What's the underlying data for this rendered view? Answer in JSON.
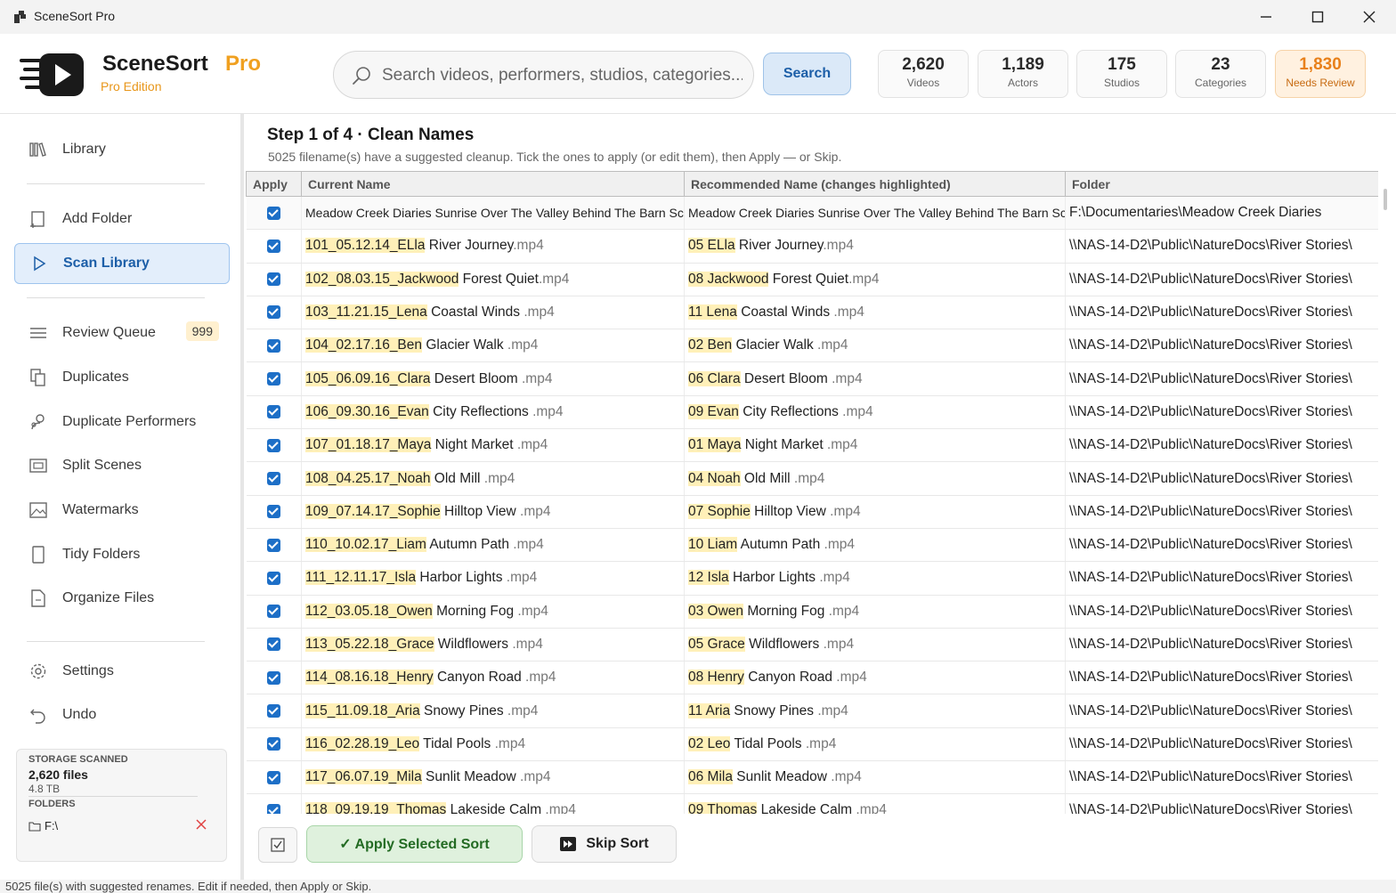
{
  "window": {
    "title": "SceneSort Pro"
  },
  "brand": {
    "name": "SceneSort",
    "pro": "Pro",
    "edition": "Pro Edition"
  },
  "search": {
    "placeholder": "Search videos, performers, studios, categories...",
    "button": "Search"
  },
  "stats": [
    {
      "value": "2,620",
      "label": "Videos"
    },
    {
      "value": "1,189",
      "label": "Actors"
    },
    {
      "value": "175",
      "label": "Studios"
    },
    {
      "value": "23",
      "label": "Categories"
    },
    {
      "value": "1,830",
      "label": "Needs Review"
    }
  ],
  "sidebar": {
    "items": [
      {
        "label": "Library",
        "icon": "library-icon"
      },
      {
        "label": "Add Folder",
        "icon": "add-folder-icon"
      },
      {
        "label": "Scan Library",
        "icon": "play-icon"
      },
      {
        "label": "Review Queue",
        "icon": "list-icon",
        "badge": "999"
      },
      {
        "label": "Duplicates",
        "icon": "copy-icon"
      },
      {
        "label": "Duplicate Performers",
        "icon": "people-icon"
      },
      {
        "label": "Split Scenes",
        "icon": "film-icon"
      },
      {
        "label": "Watermarks",
        "icon": "image-icon"
      },
      {
        "label": "Tidy Folders",
        "icon": "folder-icon"
      },
      {
        "label": "Organize Files",
        "icon": "file-icon"
      },
      {
        "label": "Settings",
        "icon": "gear-icon"
      },
      {
        "label": "Undo",
        "icon": "undo-icon"
      }
    ],
    "storage": {
      "caption": "STORAGE SCANNED",
      "files": "2,620 files",
      "size": "4.8 TB",
      "folders_caption": "FOLDERS",
      "folder": "F:\\"
    }
  },
  "step": {
    "title": "Step 1 of 4 · Clean Names",
    "subtitle": "5025 filename(s) have a suggested cleanup. Tick the ones to apply (or edit them), then Apply — or Skip."
  },
  "table": {
    "headers": [
      "Apply",
      "Current Name",
      "Recommended Name (changes highlighted)",
      "Folder"
    ],
    "first_row": {
      "current": "Meadow Creek Diaries Sunrise Over The Valley Behind The Barn Scene",
      "recommended": "Meadow Creek Diaries Sunrise Over The Valley Behind The Barn Scene",
      "folder": "F:\\Documentaries\\Meadow Creek Diaries"
    },
    "rows": [
      {
        "cur_hl": "101_05.12.14_ELla",
        "rec_hl": "05 ELla",
        "title": " River Journey",
        "ext": ".mp4"
      },
      {
        "cur_hl": "102_08.03.15_Jackwood",
        "rec_hl": "08 Jackwood",
        "title": " Forest Quiet",
        "ext": ".mp4"
      },
      {
        "cur_hl": "103_11.21.15_Lena",
        "rec_hl": "11 Lena",
        "title": " Coastal Winds",
        "ext": " .mp4"
      },
      {
        "cur_hl": "104_02.17.16_Ben",
        "rec_hl": "02 Ben",
        "title": " Glacier Walk",
        "ext": " .mp4"
      },
      {
        "cur_hl": "105_06.09.16_Clara",
        "rec_hl": "06 Clara",
        "title": " Desert Bloom",
        "ext": " .mp4"
      },
      {
        "cur_hl": "106_09.30.16_Evan",
        "rec_hl": "09 Evan",
        "title": " City Reflections",
        "ext": " .mp4"
      },
      {
        "cur_hl": "107_01.18.17_Maya",
        "rec_hl": "01 Maya",
        "title": " Night Market",
        "ext": " .mp4"
      },
      {
        "cur_hl": "108_04.25.17_Noah",
        "rec_hl": "04 Noah",
        "title": " Old Mill",
        "ext": " .mp4"
      },
      {
        "cur_hl": "109_07.14.17_Sophie",
        "rec_hl": "07 Sophie",
        "title": " Hilltop View",
        "ext": " .mp4"
      },
      {
        "cur_hl": "110_10.02.17_Liam",
        "rec_hl": "10 Liam",
        "title": " Autumn Path",
        "ext": " .mp4"
      },
      {
        "cur_hl": "111_12.11.17_Isla",
        "rec_hl": "12 Isla",
        "title": " Harbor Lights",
        "ext": " .mp4"
      },
      {
        "cur_hl": "112_03.05.18_Owen",
        "rec_hl": "03 Owen",
        "title": " Morning Fog",
        "ext": " .mp4"
      },
      {
        "cur_hl": "113_05.22.18_Grace",
        "rec_hl": "05 Grace",
        "title": " Wildflowers",
        "ext": " .mp4"
      },
      {
        "cur_hl": "114_08.16.18_Henry",
        "rec_hl": "08 Henry",
        "title": " Canyon Road",
        "ext": " .mp4"
      },
      {
        "cur_hl": "115_11.09.18_Aria",
        "rec_hl": "11 Aria",
        "title": " Snowy Pines",
        "ext": " .mp4"
      },
      {
        "cur_hl": "116_02.28.19_Leo",
        "rec_hl": "02 Leo",
        "title": " Tidal Pools",
        "ext": " .mp4"
      },
      {
        "cur_hl": "117_06.07.19_Mila",
        "rec_hl": "06 Mila",
        "title": " Sunlit Meadow",
        "ext": " .mp4"
      },
      {
        "cur_hl": "118_09.19.19_Thomas",
        "rec_hl": "09 Thomas",
        "title": " Lakeside Calm",
        "ext": " .mp4"
      }
    ],
    "row_folder": "\\\\NAS-14-D2\\Public\\NatureDocs\\River Stories\\"
  },
  "actions": {
    "apply": "✓ Apply Selected  Sort",
    "skip": "Skip  Sort"
  },
  "status": "5025 file(s) with suggested renames. Edit if needed, then Apply or Skip.",
  "colors": {
    "accent": "#1d6fc7",
    "brand": "#f0a020",
    "highlight": "#fff0b8",
    "apply": "#dff1dd"
  }
}
